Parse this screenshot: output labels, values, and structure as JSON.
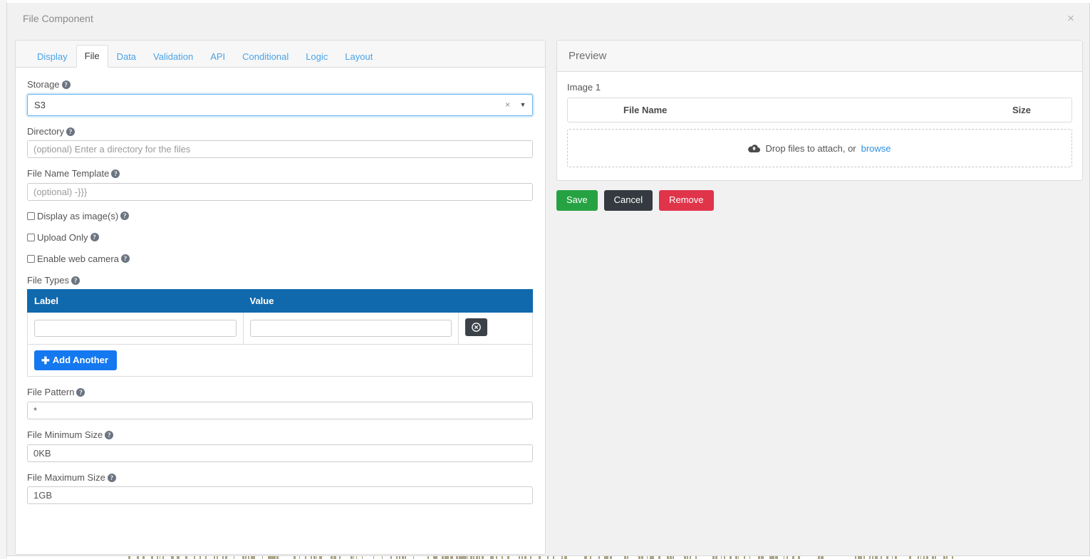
{
  "modal": {
    "title": "File Component",
    "close_label": "×"
  },
  "tabs": [
    {
      "label": "Display",
      "active": false
    },
    {
      "label": "File",
      "active": true
    },
    {
      "label": "Data",
      "active": false
    },
    {
      "label": "Validation",
      "active": false
    },
    {
      "label": "API",
      "active": false
    },
    {
      "label": "Conditional",
      "active": false
    },
    {
      "label": "Logic",
      "active": false
    },
    {
      "label": "Layout",
      "active": false
    }
  ],
  "form": {
    "storage": {
      "label": "Storage",
      "value": "S3",
      "clear_label": "×",
      "caret_label": "▼"
    },
    "directory": {
      "label": "Directory",
      "value": "",
      "placeholder": "(optional) Enter a directory for the files"
    },
    "file_name_template": {
      "label": "File Name Template",
      "value": "",
      "placeholder": "(optional) -}}}"
    },
    "checkboxes": [
      {
        "label": "Display as image(s)",
        "checked": false
      },
      {
        "label": "Upload Only",
        "checked": false
      },
      {
        "label": "Enable web camera",
        "checked": false
      }
    ],
    "file_types": {
      "label": "File Types",
      "columns": [
        "Label",
        "Value",
        ""
      ],
      "rows": [
        {
          "label_value": "",
          "value_value": "",
          "remove_icon": "circle-x-icon"
        }
      ],
      "add_button": "Add Another"
    },
    "file_pattern": {
      "label": "File Pattern",
      "value": "*"
    },
    "file_min_size": {
      "label": "File Minimum Size",
      "value": "0KB"
    },
    "file_max_size": {
      "label": "File Maximum Size",
      "value": "1GB"
    },
    "help_glyph": "?"
  },
  "preview": {
    "title": "Preview",
    "image_label": "Image 1",
    "file_table": {
      "columns": [
        "File Name",
        "Size"
      ]
    },
    "dropzone": {
      "icon": "cloud-upload-icon",
      "text": "Drop files to attach, or",
      "link": "browse"
    },
    "actions": {
      "save": "Save",
      "cancel": "Cancel",
      "remove": "Remove"
    }
  },
  "colors": {
    "tab_link": "#49a3e8",
    "table_header": "#1069ad",
    "add_button": "#1478f0",
    "save": "#27a243",
    "cancel": "#343a40",
    "remove": "#e0344b",
    "link": "#2f8fe0"
  }
}
